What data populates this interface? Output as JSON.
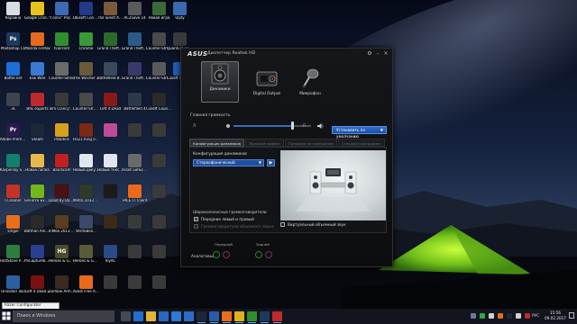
{
  "desktop": {
    "icons": [
      {
        "label": "Корзина",
        "glyph": "",
        "color": "#d9dde2"
      },
      {
        "label": "Photoshop CC",
        "glyph": "Ps",
        "color": "#1b3a5c"
      },
      {
        "label": "Battle.net",
        "glyph": "",
        "color": "#1d6fd6"
      },
      {
        "label": "ЗL",
        "glyph": "",
        "color": "#3d4450"
      },
      {
        "label": "Adobe Premiere P...",
        "glyph": "Pr",
        "color": "#2a1b4d"
      },
      {
        "label": "Kaspersky Secure Co...",
        "glyph": "",
        "color": "#12806a"
      },
      {
        "label": "CCleaner",
        "glyph": "",
        "color": "#c23328"
      },
      {
        "label": "Origin",
        "glyph": "",
        "color": "#e86e1c"
      },
      {
        "label": "FastStone Photo...",
        "glyph": "",
        "color": "#2d7d3c"
      },
      {
        "label": "Uninstall Tool",
        "glyph": "",
        "color": "#2c5fa0"
      },
      {
        "label": "Google Chrome",
        "glyph": "",
        "color": "#e8c21c"
      },
      {
        "label": "Mozilla Firefox",
        "glyph": "",
        "color": "#e36b1d"
      },
      {
        "label": "ESE Wite",
        "glyph": "",
        "color": "#3a7ad3"
      },
      {
        "label": "BAL eSports",
        "glyph": "",
        "color": "#c0282f"
      },
      {
        "label": "Steam",
        "glyph": "",
        "color": "#1c2838"
      },
      {
        "label": "Новая папка",
        "glyph": "",
        "color": "#e6b84a"
      },
      {
        "label": "GeForce Experience",
        "glyph": "",
        "color": "#74b71b"
      },
      {
        "label": "Batman Arkham Ci...",
        "glyph": "",
        "color": "#2a2a2a"
      },
      {
        "label": "PSCapture64...",
        "glyph": "",
        "color": "#2a3f8f"
      },
      {
        "label": "Left 4 Dead 2",
        "glyph": "",
        "color": "#7a1111"
      },
      {
        "label": "\"Голос\" Россия",
        "glyph": "",
        "color": "#3c6bb3"
      },
      {
        "label": "tLTorrent",
        "glyph": "",
        "color": "#2f8f2f"
      },
      {
        "label": "Counter-Strike",
        "glyph": "",
        "color": "#6b6b6b"
      },
      {
        "label": "Tom Clancy's Rainbow Six",
        "glyph": "",
        "color": "#3a3a3a"
      },
      {
        "label": "Paladins",
        "glyph": "",
        "color": "#d6a01c"
      },
      {
        "label": "Bandicam",
        "glyph": "",
        "color": "#c02020"
      },
      {
        "label": "Dead by Daylight",
        "glyph": "",
        "color": "#4b1010"
      },
      {
        "label": "InMoo 2013 Redux",
        "glyph": "",
        "color": "#5a3d22"
      },
      {
        "label": "Heroes & Generals",
        "glyph": "HG",
        "color": "#4b4b2e"
      },
      {
        "label": "Zombie Army Trilogy",
        "glyph": "",
        "color": "#3b2a20"
      },
      {
        "label": "Ubisoft Connect",
        "glyph": "",
        "color": "#233a8a"
      },
      {
        "label": "Chrome",
        "glyph": "",
        "color": "#3a9a3a"
      },
      {
        "label": "The Witcher 3",
        "glyph": "",
        "color": "#6a5a3a"
      },
      {
        "label": "Counter-Str... Global Off.",
        "glyph": "",
        "color": "#4a4a4a"
      },
      {
        "label": "H1Z1 King of the Kill",
        "glyph": "",
        "color": "#7a2a14"
      },
      {
        "label": "Новый документ",
        "glyph": "",
        "color": "#dfe6ee"
      },
      {
        "label": "Metro 2033 Redux",
        "glyph": "",
        "color": "#2f3a2a"
      },
      {
        "label": "VermiBon...",
        "glyph": "",
        "color": "#3a4a6a"
      },
      {
        "label": "Heroes & Generals",
        "glyph": "",
        "color": "#5a5a3a"
      },
      {
        "label": "Avast Free Antivirus",
        "glyph": "",
        "color": "#e86a1a"
      },
      {
        "label": "The Silent Age",
        "glyph": "",
        "color": "#7a5a3a"
      },
      {
        "label": "Grand Theft Auto V",
        "glyph": "",
        "color": "#2a6a2a"
      },
      {
        "label": "Battlefield Bad Com...",
        "glyph": "",
        "color": "#3a4a5a"
      },
      {
        "label": "Left 4 Dead",
        "glyph": "",
        "color": "#8a1a1a"
      },
      {
        "label": "",
        "glyph": "",
        "color": "#c04a9a"
      },
      {
        "label": "Новый текст. док.",
        "glyph": "",
        "color": "#dfe6ee"
      },
      {
        "label": "",
        "glyph": "",
        "color": "#1a1a1a"
      },
      {
        "label": "",
        "glyph": "",
        "color": "#3a2a1a"
      },
      {
        "label": "myAC",
        "glyph": "",
        "color": "#2a4a8a"
      },
      {
        "label": "",
        "glyph": "",
        "color": "#3a3a3a"
      },
      {
        "label": "AC2Save 14",
        "glyph": "",
        "color": "#5a5a5a"
      },
      {
        "label": "Grand Theft Auto San",
        "glyph": "",
        "color": "#2a5a8a"
      },
      {
        "label": "Grand Theft Auto IV",
        "glyph": "",
        "color": "#3a3a6a"
      },
      {
        "label": "Battlefield 4",
        "glyph": "",
        "color": "#2a3a4a"
      },
      {
        "label": "",
        "glyph": "",
        "color": "#3a3a3a"
      },
      {
        "label": "Asset SafeZo...",
        "glyph": "",
        "color": "#6a6a6a"
      },
      {
        "label": "FACE IT Client",
        "glyph": "",
        "color": "#e86a1a"
      },
      {
        "label": "",
        "glyph": "",
        "color": "#3a3a3a"
      },
      {
        "label": "",
        "glyph": "",
        "color": "#3a3a3a"
      },
      {
        "label": "",
        "glyph": "",
        "color": "#3a3a3a"
      },
      {
        "label": "Новая игра",
        "glyph": "",
        "color": "#3a6a3a"
      },
      {
        "label": "Counter-Strike Source",
        "glyph": "",
        "color": "#4a4a4a"
      },
      {
        "label": "Counter-Strike 1.6",
        "glyph": "",
        "color": "#5a5a5a"
      },
      {
        "label": "Ciisoft Counter",
        "glyph": "",
        "color": "#2a2a2a"
      },
      {
        "label": "",
        "glyph": "",
        "color": "#3a3a3a"
      },
      {
        "label": "",
        "glyph": "",
        "color": "#3a3a3a"
      },
      {
        "label": "",
        "glyph": "",
        "color": "#3a3a3a"
      },
      {
        "label": "",
        "glyph": "",
        "color": "#3a3a3a"
      },
      {
        "label": "",
        "glyph": "",
        "color": "#3a3a3a"
      },
      {
        "label": "",
        "glyph": "",
        "color": "#3a3a3a"
      },
      {
        "label": "Ulpfy",
        "glyph": "",
        "color": "#3a6ab0"
      },
      {
        "label": "Quantum Break",
        "glyph": "",
        "color": "#3a3a3a"
      },
      {
        "label": "Ciisoft Counter",
        "glyph": "",
        "color": "#1e5fbd"
      }
    ]
  },
  "window": {
    "brand": "ASUS",
    "title": "Диспетчер Realtek HD",
    "devices": [
      {
        "label": "Динамики"
      },
      {
        "label": "Digital Output"
      },
      {
        "label": "Микрофон"
      }
    ],
    "volume": {
      "label": "Главная громкость",
      "left": "Л",
      "right": "П",
      "level": 0.77,
      "default_button": "Установить по умолчанию"
    },
    "tabs": [
      {
        "label": "Конфигурация динамиков",
        "active": true
      },
      {
        "label": "Звуковой эффект",
        "active": false
      },
      {
        "label": "Поправка на помещение",
        "active": false
      },
      {
        "label": "Стандартный формат",
        "active": false
      }
    ],
    "config": {
      "label": "Конфигурация динамиков",
      "selected": "Стереофонический",
      "fullrange_label": "Широкополосные громкоговорители",
      "front_lr": "Передние левый и правый",
      "surround": "Громкоговорители объемного звука",
      "virtual": "Виртуальный объемный звук"
    },
    "connectors": {
      "analog_label": "Аналоговый",
      "back_panel": "Передний",
      "front_panel": "Задний"
    }
  },
  "taskbar": {
    "search_placeholder": "Поиск в Windows",
    "apps": [
      {
        "name": "task-view",
        "color": "#444a55"
      },
      {
        "name": "edge",
        "color": "#1f6fd0"
      },
      {
        "name": "explorer",
        "color": "#e2b43a"
      },
      {
        "name": "store",
        "color": "#2a66c2"
      },
      {
        "name": "mail",
        "color": "#2a7ad6"
      },
      {
        "name": "media",
        "color": "#2f6cc7"
      },
      {
        "name": "steam",
        "color": "#1c2838"
      },
      {
        "name": "uplay",
        "color": "#2a5aa8"
      },
      {
        "name": "origin",
        "color": "#e86e1c"
      },
      {
        "name": "chrome",
        "color": "#dcb21a"
      },
      {
        "name": "torrent",
        "color": "#2f8f2f"
      },
      {
        "name": "photoshop",
        "color": "#1b3a5c"
      },
      {
        "name": "realtek",
        "color": "#c02a2a"
      }
    ],
    "language": "РУС",
    "time": "15:56",
    "date": "09.02.2017"
  },
  "tooltip": "Razer Configurator"
}
